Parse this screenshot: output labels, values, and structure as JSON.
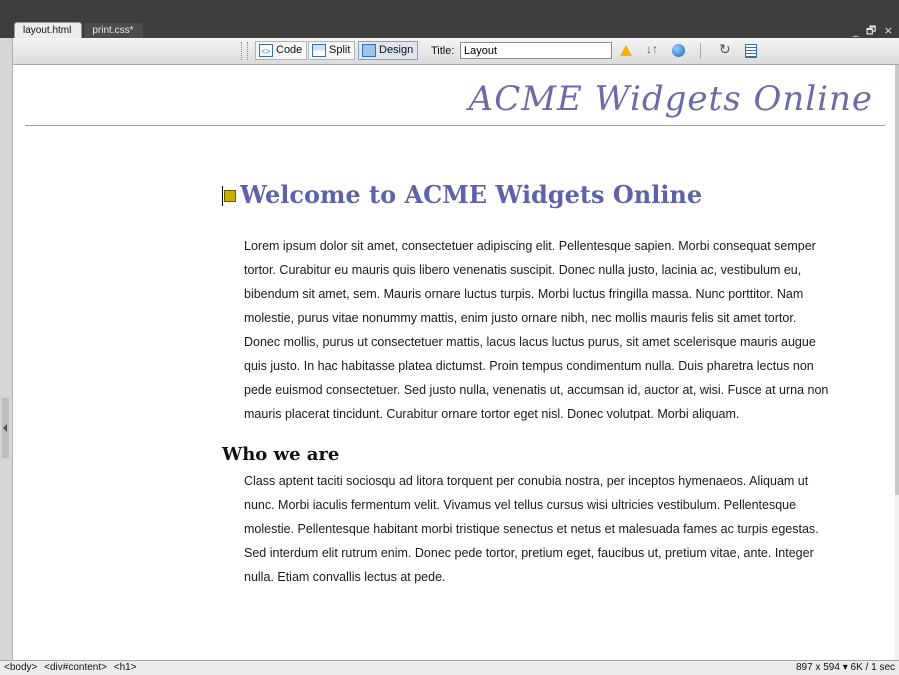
{
  "tabs": [
    {
      "label": "layout.html",
      "active": true
    },
    {
      "label": "print.css*",
      "active": false
    }
  ],
  "window_controls": {
    "minimize": "_",
    "restore": "🗗",
    "close": "×"
  },
  "toolbar": {
    "code_label": "Code",
    "split_label": "Split",
    "design_label": "Design",
    "selected_view": "Design",
    "title_label": "Title:",
    "title_value": "Layout"
  },
  "page": {
    "site_title": "ACME Widgets Online",
    "heading": "Welcome to ACME Widgets Online",
    "paragraph1": "Lorem ipsum dolor sit amet, consectetuer adipiscing elit. Pellentesque sapien. Morbi consequat semper tortor. Curabitur eu mauris quis libero venenatis suscipit. Donec nulla justo, lacinia ac, vestibulum eu, bibendum sit amet, sem. Mauris ornare luctus turpis. Morbi luctus fringilla massa. Nunc porttitor. Nam molestie, purus vitae nonummy mattis, enim justo ornare nibh, nec mollis mauris felis sit amet tortor. Donec mollis, purus ut consectetuer mattis, lacus lacus luctus purus, sit amet scelerisque mauris augue quis justo. In hac habitasse platea dictumst. Proin tempus condimentum nulla. Duis pharetra lectus non pede euismod consectetuer. Sed justo nulla, venenatis ut, accumsan id, auctor at, wisi. Fusce at urna non mauris placerat tincidunt. Curabitur ornare tortor eget nisl. Donec volutpat. Morbi aliquam.",
    "subheading": "Who we are",
    "paragraph2": "Class aptent taciti sociosqu ad litora torquent per conubia nostra, per inceptos hymenaeos. Aliquam ut nunc. Morbi iaculis fermentum velit. Vivamus vel tellus cursus wisi ultricies vestibulum. Pellentesque molestie. Pellentesque habitant morbi tristique senectus et netus et malesuada fames ac turpis egestas. Sed interdum elit rutrum enim. Donec pede tortor, pretium eget, faucibus ut, pretium vitae, ante. Integer nulla. Etiam convallis lectus at pede."
  },
  "status": {
    "tags": [
      "<body>",
      "<div#content>",
      "<h1>"
    ],
    "window_size": "897 x 594",
    "download": "6K / 1 sec"
  },
  "colors": {
    "heading": "#5e62a8",
    "site_title": "#6b6ba8",
    "tab_bar": "#3e3e3e"
  },
  "icons": [
    "code-view-icon",
    "split-view-icon",
    "design-view-icon",
    "browser-compatibility-icon",
    "file-management-icon",
    "preview-globe-icon",
    "refresh-icon",
    "view-options-icon"
  ]
}
